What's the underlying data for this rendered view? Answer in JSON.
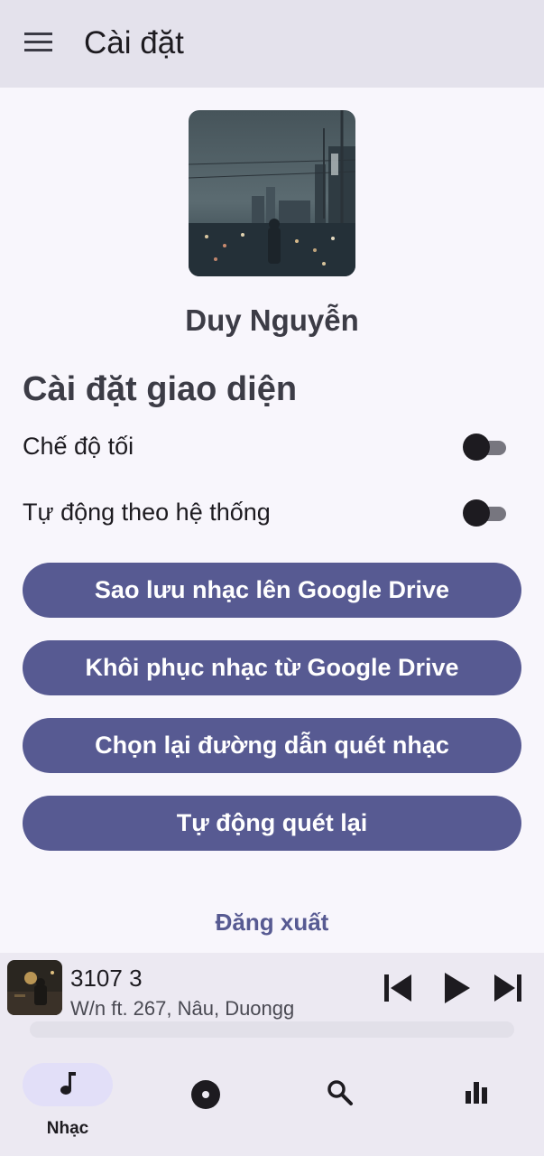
{
  "appbar": {
    "title": "Cài đặt"
  },
  "profile": {
    "name": "Duy Nguyễn"
  },
  "appearance": {
    "title": "Cài đặt giao diện",
    "dark_mode_label": "Chế độ tối",
    "dark_mode_on": false,
    "follow_system_label": "Tự động theo hệ thống",
    "follow_system_on": false
  },
  "actions": {
    "backup": "Sao lưu nhạc lên Google Drive",
    "restore": "Khôi phục nhạc từ Google Drive",
    "rescan_path": "Chọn lại đường dẫn quét nhạc",
    "auto_rescan": "Tự động quét lại",
    "logout": "Đăng xuất"
  },
  "player": {
    "title": "3107 3",
    "artist": "W/n ft. 267, Nâu, Duongg",
    "progress": 0
  },
  "nav": {
    "active": "music",
    "items": [
      {
        "id": "music",
        "label": "Nhạc",
        "icon": "music-note-icon"
      },
      {
        "id": "albums",
        "label": "",
        "icon": "disc-icon"
      },
      {
        "id": "search",
        "label": "",
        "icon": "search-icon"
      },
      {
        "id": "stats",
        "label": "",
        "icon": "bar-chart-icon"
      }
    ]
  },
  "colors": {
    "primary": "#575a92",
    "appbar_bg": "#e4e2ec",
    "player_bg": "#ece9f2",
    "nav_active": "#e2dff8"
  }
}
